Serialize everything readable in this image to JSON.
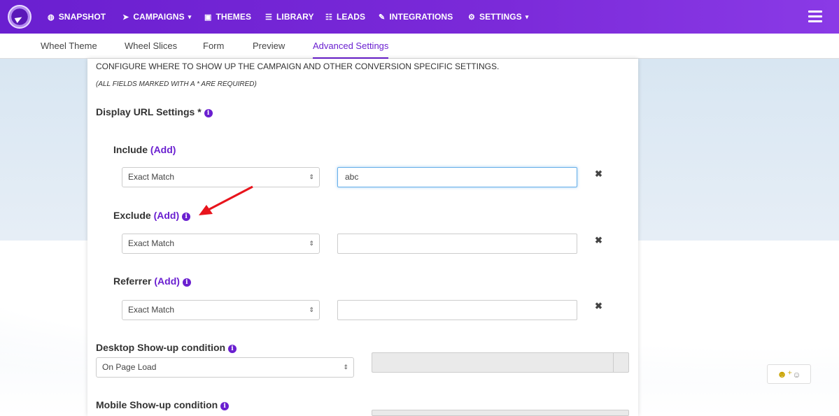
{
  "nav": {
    "items": [
      {
        "label": "SNAPSHOT",
        "icon": "dashboard-icon",
        "glyph": "◍"
      },
      {
        "label": "CAMPAIGNS",
        "icon": "paper-plane-icon",
        "glyph": "➤",
        "dropdown": true
      },
      {
        "label": "THEMES",
        "icon": "image-icon",
        "glyph": "▣"
      },
      {
        "label": "LIBRARY",
        "icon": "library-icon",
        "glyph": "☰"
      },
      {
        "label": "LEADS",
        "icon": "list-icon",
        "glyph": "☷"
      },
      {
        "label": "INTEGRATIONS",
        "icon": "plug-icon",
        "glyph": "✎"
      },
      {
        "label": "SETTINGS",
        "icon": "cogs-icon",
        "glyph": "⚙",
        "dropdown": true
      }
    ],
    "caret": "▾"
  },
  "tabs": [
    "Wheel Theme",
    "Wheel Slices",
    "Form",
    "Preview",
    "Advanced Settings"
  ],
  "active_tab": "Advanced Settings",
  "panel": {
    "description": "CONFIGURE WHERE TO SHOW UP THE CAMPAIGN AND OTHER CONVERSION SPECIFIC SETTINGS.",
    "required_note": "(ALL FIELDS MARKED WITH A * ARE REQUIRED)",
    "display_url_title": "Display URL Settings *",
    "include": {
      "label": "Include",
      "add": "(Add)",
      "match": "Exact Match",
      "value": "abc"
    },
    "exclude": {
      "label": "Exclude",
      "add": "(Add)",
      "match": "Exact Match",
      "value": ""
    },
    "referrer": {
      "label": "Referrer",
      "add": "(Add)",
      "match": "Exact Match",
      "value": ""
    },
    "desktop": {
      "label": "Desktop Show-up condition",
      "value": "On Page Load"
    },
    "mobile": {
      "label": "Mobile Show-up condition"
    }
  },
  "glyphs": {
    "info": "i",
    "remove": "✖",
    "updown": "⇕"
  },
  "colors": {
    "accent": "#6a1fd0",
    "arrow": "#e8141c"
  }
}
